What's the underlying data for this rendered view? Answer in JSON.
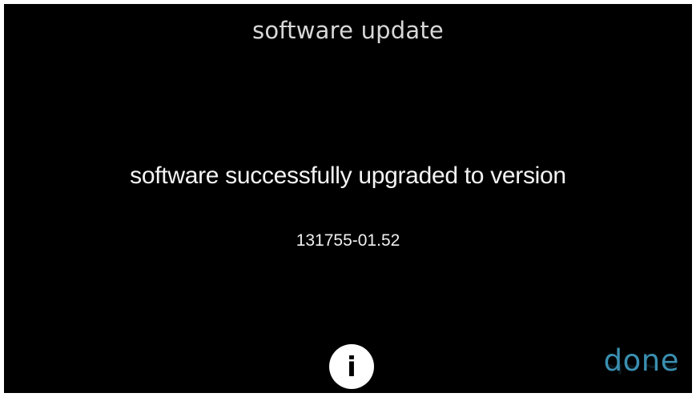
{
  "screen": {
    "title": "software update",
    "message": "software successfully upgraded to version",
    "version": "131755-01.52"
  },
  "buttons": {
    "info_label": "i",
    "info_icon": "info-icon",
    "done_label": "done"
  },
  "colors": {
    "background": "#000000",
    "accent": "#3a8fb0",
    "text": "#f4f4f4"
  }
}
